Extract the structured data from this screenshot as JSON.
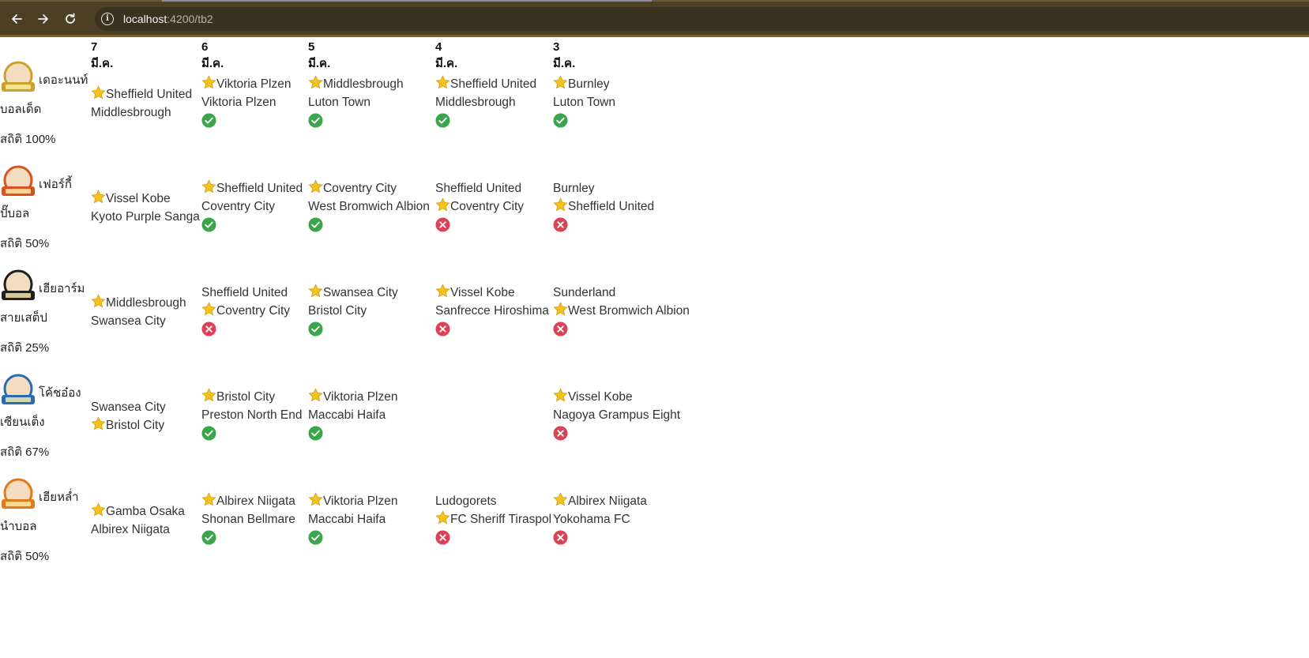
{
  "browser": {
    "url_host": "localhost",
    "url_path": ":4200/tb2"
  },
  "dates": [
    "7 มี.ค.",
    "6 มี.ค.",
    "5 มี.ค.",
    "4 มี.ค.",
    "3 มี.ค."
  ],
  "users": [
    {
      "name": "เดอะนนท์",
      "sub": "บอลเด็ด",
      "stat": "สถิติ 100%",
      "avatar_color": "#c9a227",
      "picks": [
        {
          "home": "Sheffield United",
          "away": "Middlesbrough",
          "star": "home",
          "result": null
        },
        {
          "home": "Viktoria Plzen",
          "away": "Viktoria Plzen",
          "star": "home",
          "result": "win"
        },
        {
          "home": "Middlesbrough",
          "away": "Luton Town",
          "star": "home",
          "result": "win"
        },
        {
          "home": "Sheffield United",
          "away": "Middlesbrough",
          "star": "home",
          "result": "win"
        },
        {
          "home": "Burnley",
          "away": "Luton Town",
          "star": "home",
          "result": "win"
        }
      ]
    },
    {
      "name": "เฟอร์กี้",
      "sub": "ปั๊บอล",
      "stat": "สถิติ 50%",
      "avatar_color": "#d9531e",
      "picks": [
        {
          "home": "Vissel Kobe",
          "away": "Kyoto Purple Sanga",
          "star": "home",
          "result": null
        },
        {
          "home": "Sheffield United",
          "away": "Coventry City",
          "star": "home",
          "result": "win"
        },
        {
          "home": "Coventry City",
          "away": "West Bromwich Albion",
          "star": "home",
          "result": "win"
        },
        {
          "home": "Sheffield United",
          "away": "Coventry City",
          "star": "away",
          "result": "lose"
        },
        {
          "home": "Burnley",
          "away": "Sheffield United",
          "star": "away",
          "result": "lose"
        }
      ]
    },
    {
      "name": "เฮียอาร์ม",
      "sub": "สายเสต็ป",
      "stat": "สถิติ 25%",
      "avatar_color": "#1f1f1f",
      "picks": [
        {
          "home": "Middlesbrough",
          "away": "Swansea City",
          "star": "home",
          "result": null
        },
        {
          "home": "Sheffield United",
          "away": "Coventry City",
          "star": "away",
          "result": "lose"
        },
        {
          "home": "Swansea City",
          "away": "Bristol City",
          "star": "home",
          "result": "win"
        },
        {
          "home": "Vissel Kobe",
          "away": "Sanfrecce Hiroshima",
          "star": "home",
          "result": "lose"
        },
        {
          "home": "Sunderland",
          "away": "West Bromwich Albion",
          "star": "away",
          "result": "lose"
        }
      ]
    },
    {
      "name": "โค้ชอ๋อง",
      "sub": "เซียนเต็ง",
      "stat": "สถิติ 67%",
      "avatar_color": "#2b6cb0",
      "picks": [
        {
          "home": "Swansea City",
          "away": "Bristol City",
          "star": "away",
          "result": null
        },
        {
          "home": "Bristol City",
          "away": "Preston North End",
          "star": "home",
          "result": "win"
        },
        {
          "home": "Viktoria Plzen",
          "away": "Maccabi Haifa",
          "star": "home",
          "result": "win"
        },
        null,
        {
          "home": "Vissel Kobe",
          "away": "Nagoya Grampus Eight",
          "star": "home",
          "result": "lose"
        }
      ]
    },
    {
      "name": "เฮียหล่ำ",
      "sub": "นำบอล",
      "stat": "สถิติ 50%",
      "avatar_color": "#e07b1a",
      "picks": [
        {
          "home": "Gamba Osaka",
          "away": "Albirex Niigata",
          "star": "home",
          "result": null
        },
        {
          "home": "Albirex Niigata",
          "away": "Shonan Bellmare",
          "star": "home",
          "result": "win"
        },
        {
          "home": "Viktoria Plzen",
          "away": "Maccabi Haifa",
          "star": "home",
          "result": "win"
        },
        {
          "home": "Ludogorets",
          "away": "FC Sheriff Tiraspol",
          "star": "away",
          "result": "lose"
        },
        {
          "home": "Albirex Niigata",
          "away": "Yokohama FC",
          "star": "home",
          "result": "lose"
        }
      ]
    }
  ],
  "colors": {
    "win": "#3aa54a",
    "lose": "#dc4256",
    "star": "#f4c21a"
  },
  "icons": {
    "star": "star-icon",
    "win": "check-circle-icon",
    "lose": "x-circle-icon"
  }
}
